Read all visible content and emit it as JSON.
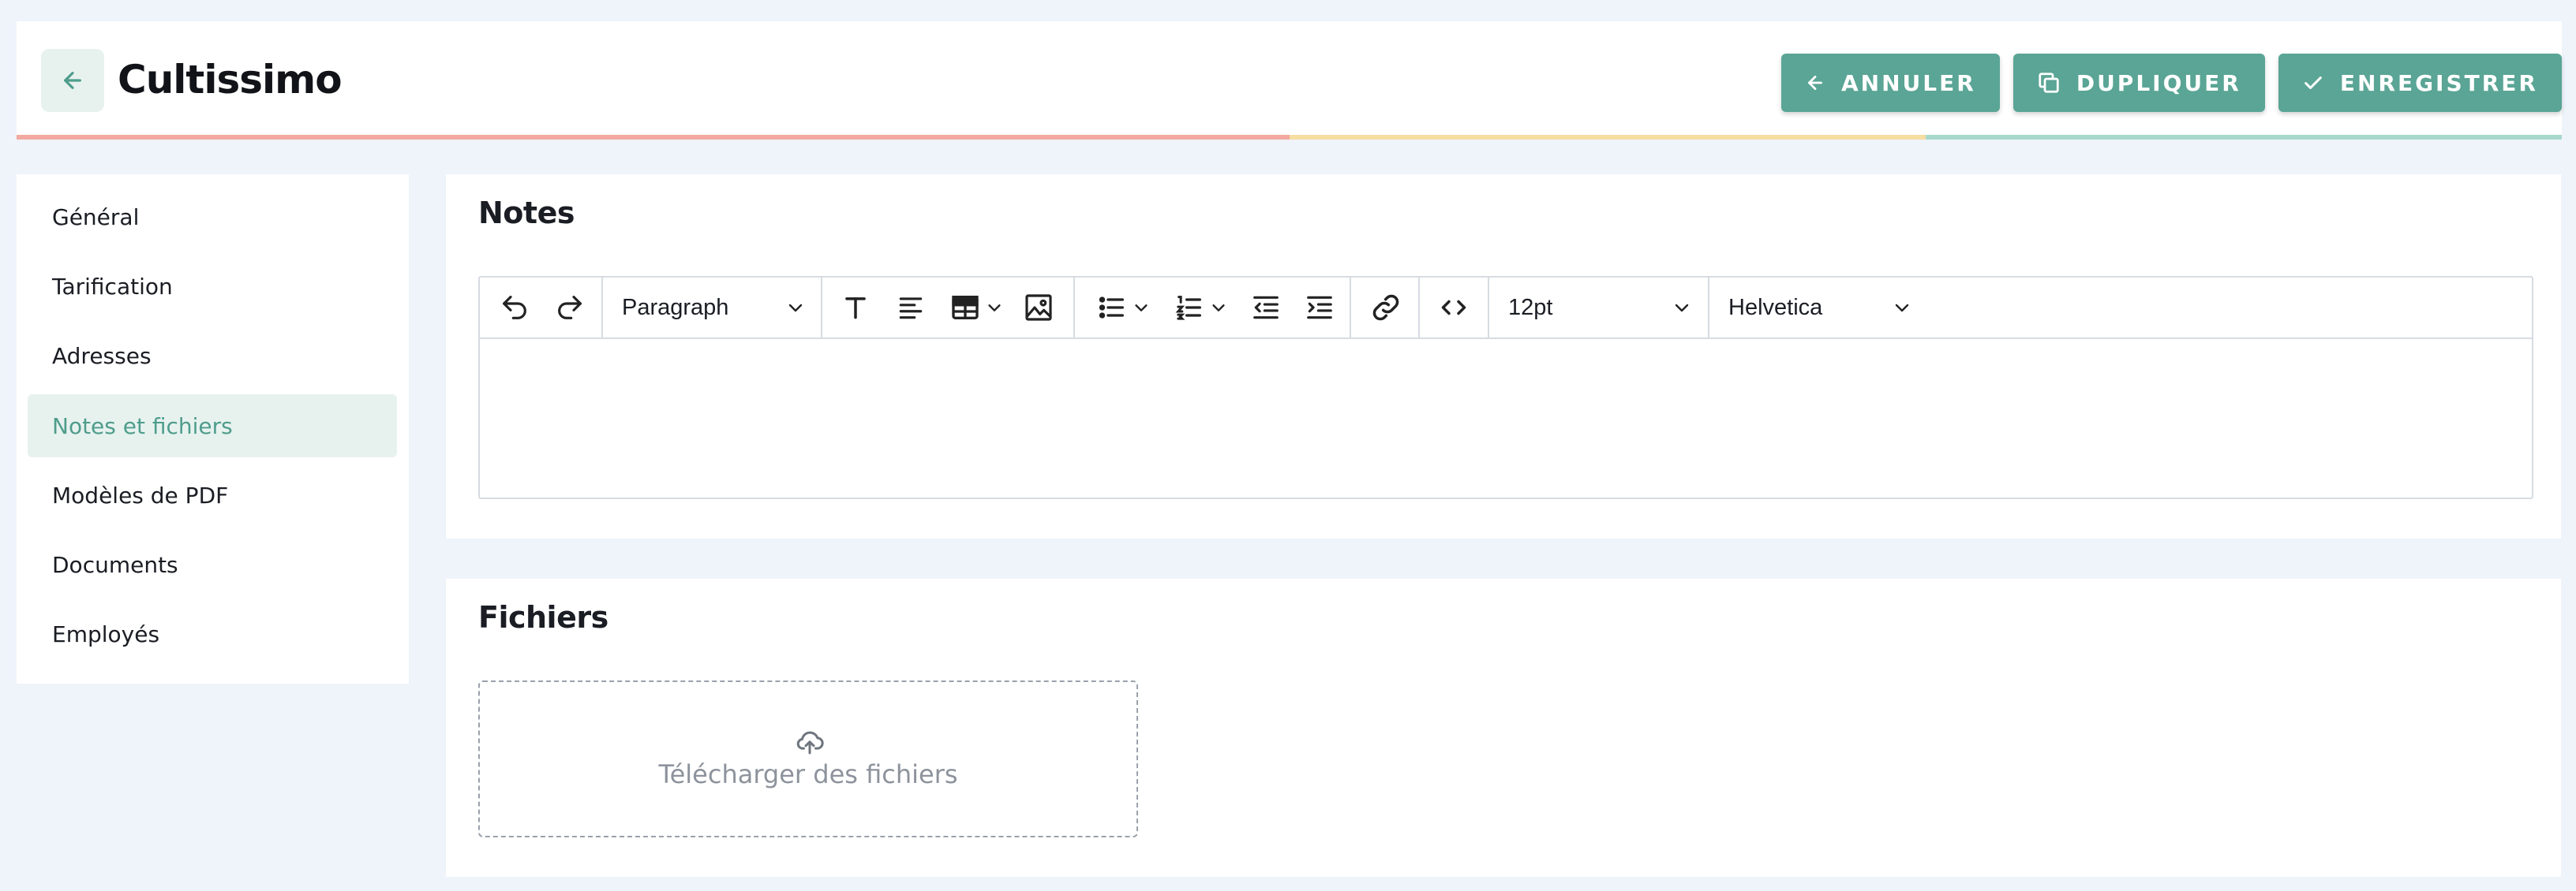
{
  "header": {
    "title": "Cultissimo",
    "back_icon": "arrow-left-icon",
    "actions": [
      {
        "label": "ANNULER",
        "icon": "arrow-left-icon"
      },
      {
        "label": "DUPLIQUER",
        "icon": "duplicate-icon"
      },
      {
        "label": "ENREGISTRER",
        "icon": "check-icon"
      }
    ],
    "progress_colors": [
      "#f2a9a0",
      "#f2a9a0",
      "#f6dda2",
      "#a8d8cb"
    ]
  },
  "sidebar": {
    "items": [
      {
        "label": "Général"
      },
      {
        "label": "Tarification"
      },
      {
        "label": "Adresses"
      },
      {
        "label": "Notes et fichiers",
        "active": true
      },
      {
        "label": "Modèles de PDF"
      },
      {
        "label": "Documents"
      },
      {
        "label": "Employés"
      }
    ]
  },
  "notes": {
    "title": "Notes",
    "toolbar": {
      "block_format": "Paragraph",
      "font_size": "12pt",
      "font_family": "Helvetica",
      "icons": [
        "undo-icon",
        "redo-icon",
        "text-format-icon",
        "align-left-icon",
        "table-icon",
        "image-icon",
        "bullet-list-icon",
        "numbered-list-icon",
        "outdent-icon",
        "indent-icon",
        "link-icon",
        "code-icon"
      ]
    },
    "content": ""
  },
  "files": {
    "title": "Fichiers",
    "upload_label": "Télécharger des fichiers",
    "upload_icon": "cloud-upload-icon"
  },
  "colors": {
    "accent": "#5aa595",
    "accent_light": "#e7f2ef",
    "background": "#eff3fa"
  }
}
